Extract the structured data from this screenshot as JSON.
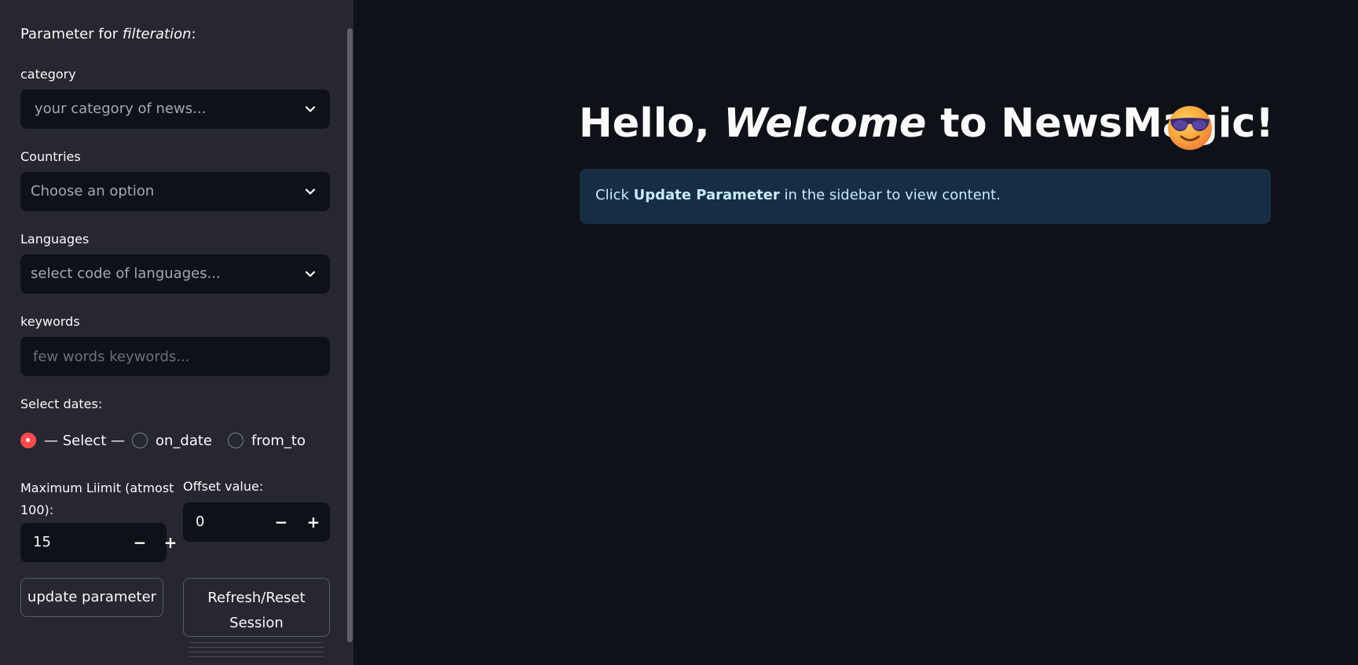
{
  "sidebar": {
    "title_prefix": "Parameter for ",
    "title_emphasis": "filteration",
    "title_suffix": ":",
    "category": {
      "label": "category",
      "placeholder": "your category of news..."
    },
    "countries": {
      "label": "Countries",
      "placeholder": "Choose an option"
    },
    "languages": {
      "label": "Languages",
      "placeholder": "select code of languages..."
    },
    "keywords": {
      "label": "keywords",
      "placeholder": "few words keywords..."
    },
    "dates": {
      "label": "Select dates:",
      "options": [
        "— Select —",
        "on_date",
        "from_to"
      ],
      "selected": "— Select —"
    },
    "max_limit": {
      "label": "Maximum Liimit (atmost 100):",
      "label_line1": "Maximum Liimit (atmost",
      "label_line2": "100):",
      "value": "15"
    },
    "offset": {
      "label": "Offset value:",
      "value": "0"
    },
    "update_button": "update parameter",
    "reset_button_line1": "Refresh/Reset",
    "reset_button_line2": "Session"
  },
  "main": {
    "title_part1": "Hello, ",
    "title_emphasis": "Welcome",
    "title_part2": " to NewsMagic!",
    "info_prefix": "Click ",
    "info_bold": "Update Parameter",
    "info_suffix": " in the sidebar to view content."
  },
  "icons": {
    "chevron": "chevron-down-icon",
    "minus": "minus-icon",
    "plus": "plus-icon",
    "emoji": "smiling-face-with-sunglasses-icon"
  },
  "colors": {
    "sidebar_bg": "#262730",
    "app_bg": "#0e1117",
    "accent": "#ff4b4b",
    "info_bg": "#172d43",
    "info_text": "#c7ebff"
  }
}
